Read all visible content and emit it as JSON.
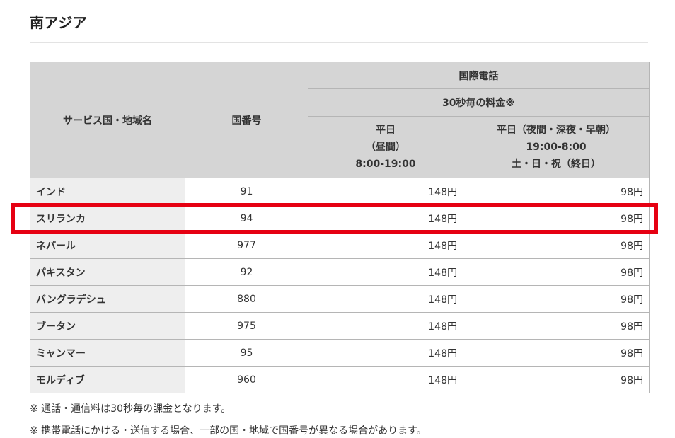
{
  "title": "南アジア",
  "table": {
    "header": {
      "country": "サービス国・地域名",
      "code": "国番号",
      "intl": "国際電話",
      "per30": "30秒毎の料金※",
      "weekday": [
        "平日",
        "（昼間）",
        "8:00-19:00"
      ],
      "night": [
        "平日（夜間・深夜・早朝）",
        "19:00-8:00",
        "土・日・祝（終日）"
      ]
    },
    "rows": [
      {
        "name": "インド",
        "code": "91",
        "day": "148円",
        "night": "98円"
      },
      {
        "name": "スリランカ",
        "code": "94",
        "day": "148円",
        "night": "98円"
      },
      {
        "name": "ネパール",
        "code": "977",
        "day": "148円",
        "night": "98円"
      },
      {
        "name": "パキスタン",
        "code": "92",
        "day": "148円",
        "night": "98円"
      },
      {
        "name": "バングラデシュ",
        "code": "880",
        "day": "148円",
        "night": "98円"
      },
      {
        "name": "ブータン",
        "code": "975",
        "day": "148円",
        "night": "98円"
      },
      {
        "name": "ミャンマー",
        "code": "95",
        "day": "148円",
        "night": "98円"
      },
      {
        "name": "モルディブ",
        "code": "960",
        "day": "148円",
        "night": "98円"
      }
    ]
  },
  "notes": [
    "※ 通話・通信料は30秒毎の課金となります。",
    "※ 携帯電話にかける・送信する場合、一部の国・地域で国番号が異なる場合があります。"
  ],
  "highlight_color": "#e60012"
}
